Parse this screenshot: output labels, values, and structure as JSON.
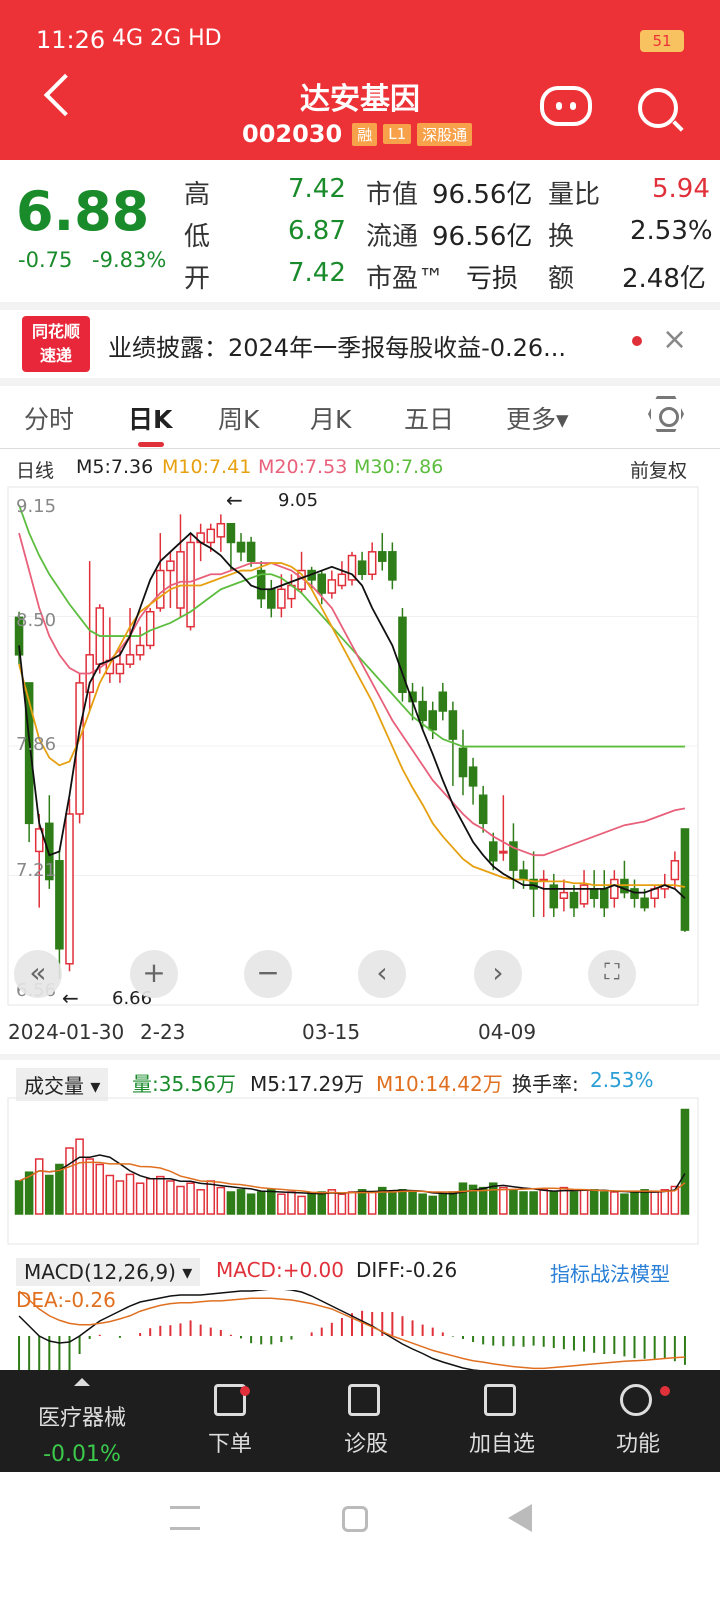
{
  "status_bar": {
    "time": "11:26",
    "signals": "4G 2G HD",
    "battery": "51"
  },
  "header": {
    "title": "达安基因",
    "code": "002030",
    "tags": [
      "融",
      "L1",
      "深股通"
    ]
  },
  "quote": {
    "price": "6.88",
    "change": "-0.75",
    "change_pct": "-9.83%",
    "high_label": "高",
    "high": "7.42",
    "low_label": "低",
    "low": "6.87",
    "open_label": "开",
    "open": "7.42",
    "mktcap_label": "市值",
    "mktcap": "96.56亿",
    "float_label": "流通",
    "float": "96.56亿",
    "pe_label": "市盈™",
    "pe": "亏损",
    "volratio_label": "量比",
    "volratio": "5.94",
    "turnover_label": "换",
    "turnover": "2.53%",
    "amount_label": "额",
    "amount": "2.48亿"
  },
  "news": {
    "logo_top": "同花顺",
    "logo_bottom": "速递",
    "text": "业绩披露：2024年一季报每股收益-0.26..."
  },
  "tabs": [
    "分时",
    "日K",
    "周K",
    "月K",
    "五日",
    "更多▾"
  ],
  "ma": {
    "label": "日线",
    "m5": "M5:7.36",
    "m10": "M10:7.41",
    "m20": "M20:7.53",
    "m30": "M30:7.86",
    "adj": "前复权"
  },
  "chart_labels": {
    "y": [
      "9.15",
      "8.50",
      "7.86",
      "7.21",
      "6.56"
    ],
    "high_mark": "9.05",
    "low_mark": "6.66"
  },
  "dates": [
    "2024-01-30",
    "2-23",
    "03-15",
    "04-09"
  ],
  "volume": {
    "label": "成交量",
    "vol": "量:35.56万",
    "m5": "M5:17.29万",
    "m10": "M10:14.42万",
    "turnover_label": "换手率:",
    "turnover": "2.53%"
  },
  "macd": {
    "label": "MACD(12,26,9)",
    "macd": "MACD:+0.00",
    "diff": "DIFF:-0.26",
    "dea": "DEA:-0.26",
    "link": "指标战法模型"
  },
  "nav": [
    {
      "label": "医疗器械",
      "sub": "-0.01%"
    },
    {
      "label": "下单"
    },
    {
      "label": "诊股"
    },
    {
      "label": "加自选"
    },
    {
      "label": "功能"
    }
  ],
  "chart_data": {
    "type": "candlestick",
    "y_range": [
      6.56,
      9.15
    ],
    "candles": [
      {
        "o": 8.55,
        "c": 8.35,
        "h": 8.58,
        "l": 8.3
      },
      {
        "o": 8.2,
        "c": 7.45,
        "h": 8.2,
        "l": 7.35
      },
      {
        "o": 7.3,
        "c": 7.42,
        "h": 7.5,
        "l": 7.0
      },
      {
        "o": 7.45,
        "c": 7.15,
        "h": 7.6,
        "l": 7.1
      },
      {
        "o": 7.25,
        "c": 6.78,
        "h": 7.3,
        "l": 6.62
      },
      {
        "o": 6.7,
        "c": 7.5,
        "h": 7.58,
        "l": 6.66
      },
      {
        "o": 7.5,
        "c": 8.2,
        "h": 8.25,
        "l": 7.45
      },
      {
        "o": 8.15,
        "c": 8.35,
        "h": 8.85,
        "l": 8.05
      },
      {
        "o": 8.3,
        "c": 8.6,
        "h": 8.62,
        "l": 8.25
      },
      {
        "o": 8.25,
        "c": 8.32,
        "h": 8.55,
        "l": 8.2
      },
      {
        "o": 8.25,
        "c": 8.3,
        "h": 8.38,
        "l": 8.2
      },
      {
        "o": 8.3,
        "c": 8.35,
        "h": 8.6,
        "l": 8.28
      },
      {
        "o": 8.35,
        "c": 8.4,
        "h": 8.5,
        "l": 8.32
      },
      {
        "o": 8.4,
        "c": 8.58,
        "h": 8.6,
        "l": 8.38
      },
      {
        "o": 8.6,
        "c": 8.8,
        "h": 9.0,
        "l": 8.58
      },
      {
        "o": 8.8,
        "c": 8.85,
        "h": 8.9,
        "l": 8.6
      },
      {
        "o": 8.6,
        "c": 8.9,
        "h": 9.1,
        "l": 8.55
      },
      {
        "o": 8.5,
        "c": 8.95,
        "h": 9.0,
        "l": 8.48
      },
      {
        "o": 8.95,
        "c": 9.0,
        "h": 9.05,
        "l": 8.85
      },
      {
        "o": 8.95,
        "c": 9.02,
        "h": 9.05,
        "l": 8.9
      },
      {
        "o": 8.98,
        "c": 9.05,
        "h": 9.1,
        "l": 8.9
      },
      {
        "o": 9.05,
        "c": 8.95,
        "h": 9.05,
        "l": 8.8
      },
      {
        "o": 8.95,
        "c": 8.9,
        "h": 9.0,
        "l": 8.85
      },
      {
        "o": 8.95,
        "c": 8.85,
        "h": 8.98,
        "l": 8.82
      },
      {
        "o": 8.8,
        "c": 8.65,
        "h": 8.85,
        "l": 8.6
      },
      {
        "o": 8.7,
        "c": 8.6,
        "h": 8.75,
        "l": 8.55
      },
      {
        "o": 8.6,
        "c": 8.7,
        "h": 8.78,
        "l": 8.55
      },
      {
        "o": 8.65,
        "c": 8.72,
        "h": 8.78,
        "l": 8.6
      },
      {
        "o": 8.7,
        "c": 8.8,
        "h": 8.9,
        "l": 8.68
      },
      {
        "o": 8.8,
        "c": 8.75,
        "h": 8.82,
        "l": 8.7
      },
      {
        "o": 8.78,
        "c": 8.68,
        "h": 8.8,
        "l": 8.62
      },
      {
        "o": 8.68,
        "c": 8.75,
        "h": 8.8,
        "l": 8.65
      },
      {
        "o": 8.72,
        "c": 8.78,
        "h": 8.85,
        "l": 8.7
      },
      {
        "o": 8.75,
        "c": 8.88,
        "h": 8.9,
        "l": 8.72
      },
      {
        "o": 8.85,
        "c": 8.78,
        "h": 8.9,
        "l": 8.75
      },
      {
        "o": 8.78,
        "c": 8.9,
        "h": 8.95,
        "l": 8.75
      },
      {
        "o": 8.9,
        "c": 8.85,
        "h": 9.0,
        "l": 8.8
      },
      {
        "o": 8.9,
        "c": 8.75,
        "h": 8.95,
        "l": 8.7
      },
      {
        "o": 8.55,
        "c": 8.15,
        "h": 8.6,
        "l": 8.1
      },
      {
        "o": 8.15,
        "c": 8.1,
        "h": 8.2,
        "l": 8.0
      },
      {
        "o": 8.1,
        "c": 8.0,
        "h": 8.18,
        "l": 7.95
      },
      {
        "o": 8.05,
        "c": 7.95,
        "h": 8.1,
        "l": 7.9
      },
      {
        "o": 8.15,
        "c": 8.05,
        "h": 8.2,
        "l": 8.0
      },
      {
        "o": 8.05,
        "c": 7.9,
        "h": 8.1,
        "l": 7.65
      },
      {
        "o": 7.85,
        "c": 7.7,
        "h": 7.95,
        "l": 7.6
      },
      {
        "o": 7.75,
        "c": 7.65,
        "h": 7.8,
        "l": 7.55
      },
      {
        "o": 7.6,
        "c": 7.45,
        "h": 7.65,
        "l": 7.4
      },
      {
        "o": 7.35,
        "c": 7.25,
        "h": 7.4,
        "l": 7.2
      },
      {
        "o": 7.3,
        "c": 7.3,
        "h": 7.6,
        "l": 7.25
      },
      {
        "o": 7.35,
        "c": 7.2,
        "h": 7.45,
        "l": 7.1
      },
      {
        "o": 7.2,
        "c": 7.15,
        "h": 7.25,
        "l": 7.1
      },
      {
        "o": 7.15,
        "c": 7.1,
        "h": 7.3,
        "l": 6.95
      },
      {
        "o": 7.15,
        "c": 7.15,
        "h": 7.2,
        "l": 6.95
      },
      {
        "o": 7.12,
        "c": 7.0,
        "h": 7.18,
        "l": 6.95
      },
      {
        "o": 7.05,
        "c": 7.08,
        "h": 7.15,
        "l": 6.98
      },
      {
        "o": 7.08,
        "c": 7.0,
        "h": 7.12,
        "l": 6.95
      },
      {
        "o": 7.02,
        "c": 7.12,
        "h": 7.2,
        "l": 7.0
      },
      {
        "o": 7.1,
        "c": 7.05,
        "h": 7.2,
        "l": 7.0
      },
      {
        "o": 7.1,
        "c": 7.0,
        "h": 7.2,
        "l": 6.95
      },
      {
        "o": 7.05,
        "c": 7.15,
        "h": 7.2,
        "l": 7.0
      },
      {
        "o": 7.15,
        "c": 7.08,
        "h": 7.25,
        "l": 7.05
      },
      {
        "o": 7.1,
        "c": 7.05,
        "h": 7.15,
        "l": 7.0
      },
      {
        "o": 7.05,
        "c": 7.0,
        "h": 7.1,
        "l": 6.98
      },
      {
        "o": 7.05,
        "c": 7.1,
        "h": 7.12,
        "l": 7.0
      },
      {
        "o": 7.1,
        "c": 7.12,
        "h": 7.18,
        "l": 7.05
      },
      {
        "o": 7.15,
        "c": 7.25,
        "h": 7.3,
        "l": 7.1
      },
      {
        "o": 7.42,
        "c": 6.88,
        "h": 7.42,
        "l": 6.87
      }
    ],
    "volume": [
      0.3,
      0.38,
      0.5,
      0.35,
      0.45,
      0.6,
      0.68,
      0.5,
      0.45,
      0.35,
      0.3,
      0.36,
      0.28,
      0.32,
      0.34,
      0.3,
      0.25,
      0.28,
      0.22,
      0.3,
      0.24,
      0.2,
      0.22,
      0.18,
      0.2,
      0.22,
      0.18,
      0.2,
      0.16,
      0.18,
      0.2,
      0.22,
      0.18,
      0.2,
      0.22,
      0.2,
      0.24,
      0.2,
      0.22,
      0.2,
      0.18,
      0.16,
      0.18,
      0.2,
      0.28,
      0.26,
      0.24,
      0.28,
      0.24,
      0.22,
      0.2,
      0.2,
      0.22,
      0.2,
      0.24,
      0.2,
      0.22,
      0.22,
      0.2,
      0.2,
      0.18,
      0.2,
      0.22,
      0.2,
      0.22,
      0.25,
      0.95
    ],
    "ma5": [
      8.4,
      7.9,
      7.45,
      7.28,
      7.3,
      7.6,
      7.95,
      8.2,
      8.3,
      8.32,
      8.35,
      8.45,
      8.6,
      8.75,
      8.85,
      8.9,
      8.95,
      9.0,
      8.95,
      8.92,
      8.88,
      8.82,
      8.78,
      8.72,
      8.7,
      8.7,
      8.72,
      8.74,
      8.76,
      8.78,
      8.8,
      8.82,
      8.8,
      8.78,
      8.72,
      8.6,
      8.5,
      8.4,
      8.25,
      8.1,
      7.95,
      7.82,
      7.68,
      7.55,
      7.45,
      7.35,
      7.28,
      7.22,
      7.18,
      7.15,
      7.12,
      7.12,
      7.1,
      7.1,
      7.1,
      7.1,
      7.1,
      7.1,
      7.1,
      7.12,
      7.1,
      7.08,
      7.08,
      7.1,
      7.12,
      7.1,
      7.05
    ],
    "ma10": [
      8.3,
      8.1,
      7.9,
      7.8,
      7.76,
      7.78,
      7.9,
      8.05,
      8.2,
      8.3,
      8.4,
      8.5,
      8.58,
      8.62,
      8.66,
      8.7,
      8.72,
      8.72,
      8.72,
      8.74,
      8.76,
      8.78,
      8.8,
      8.8,
      8.82,
      8.84,
      8.84,
      8.82,
      8.78,
      8.7,
      8.6,
      8.5,
      8.4,
      8.3,
      8.2,
      8.1,
      7.98,
      7.86,
      7.74,
      7.64,
      7.55,
      7.45,
      7.38,
      7.32,
      7.26,
      7.22,
      7.2,
      7.18,
      7.16,
      7.15,
      7.15,
      7.14,
      7.14,
      7.14,
      7.14,
      7.13,
      7.13,
      7.12,
      7.12,
      7.12,
      7.12,
      7.12,
      7.12,
      7.12,
      7.12,
      7.12,
      7.11
    ],
    "ma20": [
      9.0,
      8.8,
      8.6,
      8.45,
      8.35,
      8.28,
      8.25,
      8.25,
      8.28,
      8.32,
      8.38,
      8.45,
      8.55,
      8.62,
      8.68,
      8.72,
      8.74,
      8.74,
      8.76,
      8.78,
      8.78,
      8.8,
      8.82,
      8.84,
      8.84,
      8.84,
      8.82,
      8.8,
      8.76,
      8.72,
      8.66,
      8.6,
      8.5,
      8.4,
      8.3,
      8.2,
      8.1,
      8.0,
      7.92,
      7.84,
      7.76,
      7.68,
      7.62,
      7.56,
      7.5,
      7.45,
      7.42,
      7.38,
      7.35,
      7.32,
      7.3,
      7.28,
      7.28,
      7.3,
      7.32,
      7.34,
      7.36,
      7.38,
      7.4,
      7.42,
      7.44,
      7.45,
      7.46,
      7.48,
      7.5,
      7.52,
      7.53
    ],
    "ma30": [
      9.15,
      9.0,
      8.88,
      8.78,
      8.7,
      8.62,
      8.55,
      8.48,
      8.45,
      8.45,
      8.45,
      8.45,
      8.45,
      8.48,
      8.5,
      8.52,
      8.55,
      8.58,
      8.62,
      8.66,
      8.7,
      8.72,
      8.74,
      8.76,
      8.78,
      8.78,
      8.76,
      8.72,
      8.68,
      8.62,
      8.56,
      8.5,
      8.44,
      8.38,
      8.32,
      8.26,
      8.2,
      8.14,
      8.08,
      8.02,
      7.98,
      7.94,
      7.9,
      7.88,
      7.86,
      7.86,
      7.86,
      7.86,
      7.86,
      7.86,
      7.86,
      7.86,
      7.86,
      7.86,
      7.86,
      7.86,
      7.86,
      7.86,
      7.86,
      7.86,
      7.86,
      7.86,
      7.86,
      7.86,
      7.86,
      7.86,
      7.86
    ]
  }
}
